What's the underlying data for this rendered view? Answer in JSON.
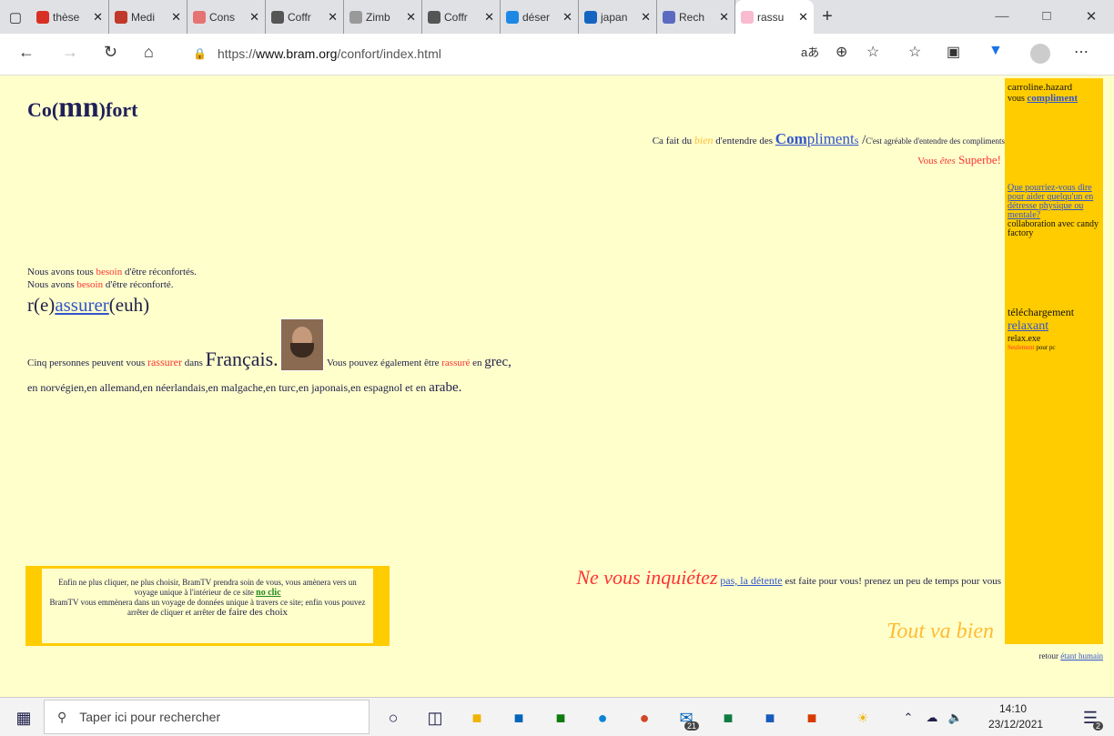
{
  "browser": {
    "tabs": [
      {
        "label": "thèse",
        "color": "#d93025"
      },
      {
        "label": "Medi",
        "color": "#c0392b"
      },
      {
        "label": "Cons",
        "color": "#e57373"
      },
      {
        "label": "Coffr",
        "color": "#555555"
      },
      {
        "label": "Zimb",
        "color": "#999999"
      },
      {
        "label": "Coffr",
        "color": "#555555"
      },
      {
        "label": "déser",
        "color": "#1e88e5"
      },
      {
        "label": "japan",
        "color": "#1565c0"
      },
      {
        "label": "Rech",
        "color": "#5c6bc0"
      },
      {
        "label": "rassu",
        "color": "#f8bbd0"
      }
    ],
    "url_prefix": "https://",
    "url_domain": "www.bram.org",
    "url_path": "/confort/index.html"
  },
  "site": {
    "logo_pre": "Co(",
    "logo_big": "mn",
    "logo_post": ")fort",
    "compliment_pre": "Ca fait du ",
    "compliment_bien": "bien",
    "compliment_mid": " d'entendre des ",
    "compliment_com": "Com",
    "compliment_pliment": "pliment",
    "compliment_s": "s",
    "compliment_slash": " /",
    "compliment_small": "C'est agréable d'entendre des compliments",
    "superbe_pre": "Vous ",
    "superbe_etes": "êtes",
    "superbe_word": " Superbe!",
    "besoin1_pre": "Nous avons tous ",
    "besoin1_word": "besoin",
    "besoin1_post": " d'être réconfortés.",
    "besoin2_pre": "Nous avons ",
    "besoin2_word": "besoin",
    "besoin2_post": " d'être réconforté.",
    "rassurer_pre": "r(e)",
    "rassurer_link": "assurer",
    "rassurer_post": "(euh)",
    "cinq_pre": "Cinq personnes   peuvent vous ",
    "cinq_rassurer": "rassurer",
    "cinq_dans": " dans ",
    "cinq_francais": "Français.",
    "cinq_egal": " Vous pouvez également être ",
    "cinq_rassure": "rassuré",
    "cinq_en": " en ",
    "cinq_grec": "grec,",
    "langs": "en norvégien,en allemand,en néerlandais,en malgache,en turc,en japonais,en espagnol et en ",
    "arabe": "arabe.",
    "inquiet_big": "Ne vous inquiétez",
    "inquiet_link": "pas, la détente",
    "inquiet_post": " est faite pour vous! prenez un peu de temps pour vous",
    "tout_va_bien": "Tout va bien",
    "bramtv_1": "Enfin ne plus cliquer, ne plus choisir, BramTV prendra soin de vous, vous amènera vers un voyage unique à l'intérieur de ce site ",
    "bramtv_noclic": "no clic",
    "bramtv_2": "BramTV vous emmènera dans un voyage de données unique à travers ce site; enfin vous pouvez arrêter de cliquer et arrêter ",
    "bramtv_3": "de faire des choix",
    "retour": "retour ",
    "retour_link": "étant humain"
  },
  "sidebar": {
    "user": "carroline.hazard",
    "vous": "vous ",
    "compliment_link": "compliment",
    "question_link": "Que pourriez-vous dire pour aider quelqu'un en détresse physique ou mentale?",
    "collab": "collaboration avec candy factory",
    "download": "téléchargement",
    "relaxant": "relaxant",
    "exe": "relax.exe",
    "seulement": "Seulement",
    "pourpc": " pour pc"
  },
  "taskbar": {
    "search_placeholder": "Taper ici pour rechercher",
    "time": "14:10",
    "date": "23/12/2021",
    "mail_badge": "21",
    "notif_badge": "2"
  }
}
